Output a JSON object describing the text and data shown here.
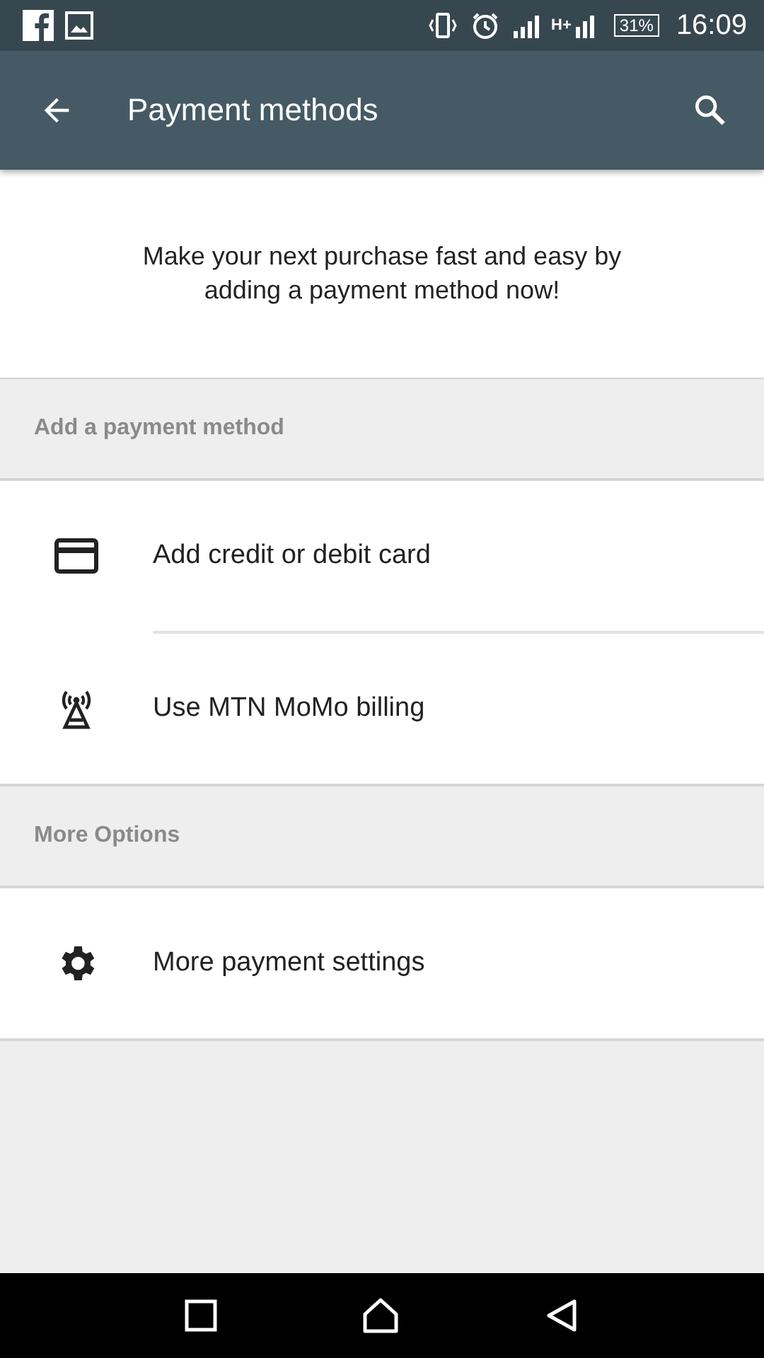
{
  "status_bar": {
    "network": "H+",
    "battery": "31%",
    "time": "16:09"
  },
  "app_bar": {
    "title": "Payment methods"
  },
  "intro": "Make your next purchase fast and easy by adding a payment method now!",
  "sections": [
    {
      "header": "Add a payment method",
      "items": [
        {
          "kind": "card",
          "label": "Add credit or debit card"
        },
        {
          "kind": "antenna",
          "label": "Use MTN MoMo billing"
        }
      ]
    },
    {
      "header": "More Options",
      "items": [
        {
          "kind": "gear",
          "label": "More payment settings"
        }
      ]
    }
  ]
}
